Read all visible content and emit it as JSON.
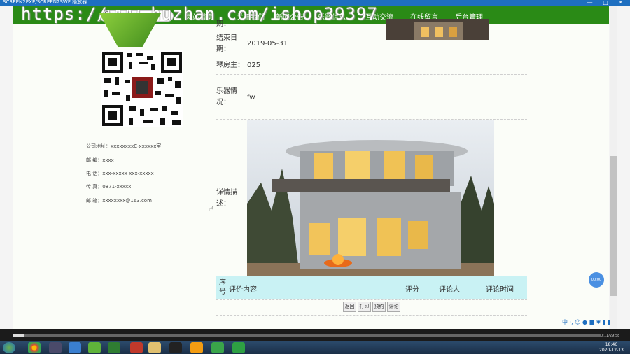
{
  "window": {
    "title": "SCREEN2EXE/SCREEN2SWF 播放器",
    "controls": [
      "—",
      "□",
      "✕"
    ]
  },
  "nav": {
    "items": [
      "网站首页",
      "关于我们",
      "新闻公告",
      "乐器信息",
      "互动交流",
      "在线留言",
      "后台管理"
    ],
    "search_placeholder": ""
  },
  "watermark": "https://www.huzhan.com/ishop39397",
  "contact": {
    "lines": [
      "公司地址：xxxxxxxxC-xxxxxx室",
      "邮      编：xxxx",
      "电      话：xxx-xxxxx  xxx-xxxxx",
      "传      真：0871-xxxxx",
      "邮      箱：xxxxxxxx@163.com"
    ]
  },
  "detail": {
    "top_partial_label": "期：",
    "end_date_label": "结束日期：",
    "end_date_value": "2019-05-31",
    "owner_label": "琴房主：",
    "owner_value": "025",
    "status_label": "乐器情况：",
    "status_value": "fw",
    "desc_label": "详情描述："
  },
  "comments": {
    "headers": [
      "序号",
      "评价内容",
      "评分",
      "评论人",
      "评论时间"
    ],
    "buttons": [
      "返回",
      "打印",
      "预约",
      "评论"
    ]
  },
  "badge": "00:00",
  "ime": "中 ·, ☺ ● ■ ✱ ▮ ▮",
  "player": {
    "time": "0:11/29:58",
    "progress": 0.02
  },
  "clock": {
    "time": "18:46",
    "date": "2020-12-13"
  },
  "colors": {
    "nav_green": "#2a8a16",
    "table_header": "#c9f2f4",
    "titlebar_blue": "#1e6fc0"
  }
}
